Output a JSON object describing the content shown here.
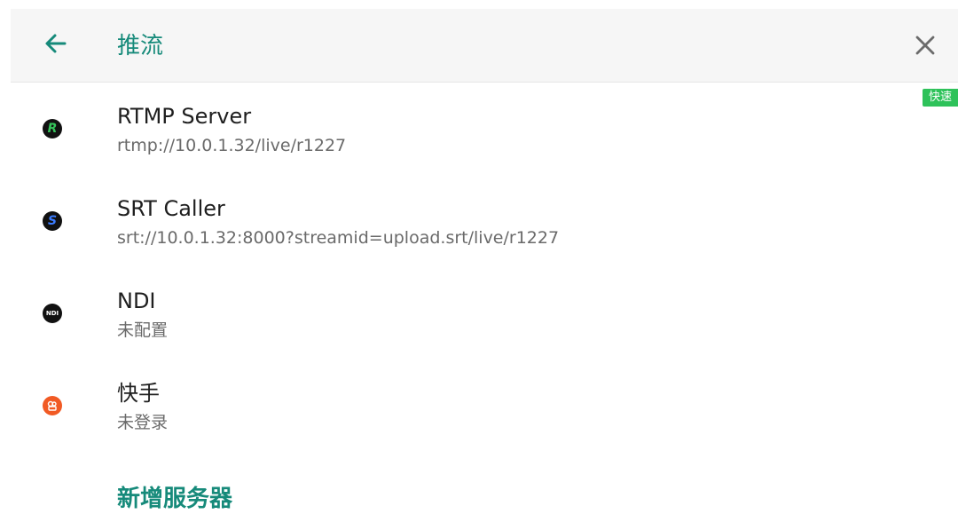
{
  "header": {
    "title": "推流"
  },
  "badge": {
    "label": "快速"
  },
  "servers": [
    {
      "name": "RTMP Server",
      "detail": "rtmp://10.0.1.32/live/r1227",
      "icon_letter": "R",
      "icon": "rtmp-icon",
      "icon_bg": "#111111",
      "icon_fg": "#35c35a"
    },
    {
      "name": "SRT Caller",
      "detail": "srt://10.0.1.32:8000?streamid=upload.srt/live/r1227",
      "icon_letter": "S",
      "icon": "srt-icon",
      "icon_bg": "#111111",
      "icon_fg": "#3b7cff"
    },
    {
      "name": "NDI",
      "detail": "未配置",
      "icon_letter": "NDI",
      "icon": "ndi-icon",
      "icon_bg": "#111111",
      "icon_fg": "#ffffff"
    },
    {
      "name": "快手",
      "detail": "未登录",
      "icon_letter": "",
      "icon": "kuaishou-icon",
      "icon_bg": "#f15a24",
      "icon_fg": "#ffffff"
    }
  ],
  "actions": {
    "add_server": "新增服务器"
  },
  "colors": {
    "accent": "#168a7a",
    "badge": "#2ec25a"
  }
}
